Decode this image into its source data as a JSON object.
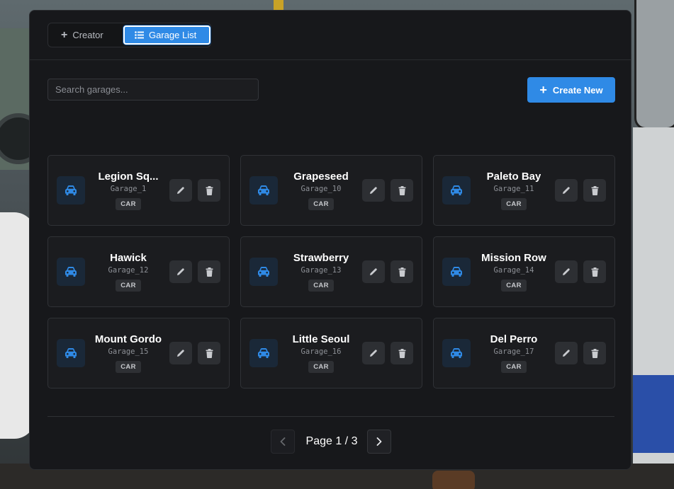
{
  "tabs": [
    {
      "label": "Creator",
      "icon": "plus-icon",
      "active": false
    },
    {
      "label": "Garage List",
      "icon": "list-icon",
      "active": true
    }
  ],
  "search": {
    "placeholder": "Search garages...",
    "value": ""
  },
  "create_button": {
    "label": "Create New",
    "icon": "plus-icon"
  },
  "colors": {
    "accent": "#2f8ae6",
    "panel": "#17181b",
    "card": "#1b1c1f"
  },
  "garages": [
    {
      "name": "Legion Sq...",
      "id": "Garage_1",
      "type": "CAR"
    },
    {
      "name": "Grapeseed",
      "id": "Garage_10",
      "type": "CAR"
    },
    {
      "name": "Paleto Bay",
      "id": "Garage_11",
      "type": "CAR"
    },
    {
      "name": "Hawick",
      "id": "Garage_12",
      "type": "CAR"
    },
    {
      "name": "Strawberry",
      "id": "Garage_13",
      "type": "CAR"
    },
    {
      "name": "Mission Row",
      "id": "Garage_14",
      "type": "CAR"
    },
    {
      "name": "Mount Gordo",
      "id": "Garage_15",
      "type": "CAR"
    },
    {
      "name": "Little Seoul",
      "id": "Garage_16",
      "type": "CAR"
    },
    {
      "name": "Del Perro",
      "id": "Garage_17",
      "type": "CAR"
    }
  ],
  "pagination": {
    "label": "Page 1 / 3",
    "current": 1,
    "total": 3
  }
}
